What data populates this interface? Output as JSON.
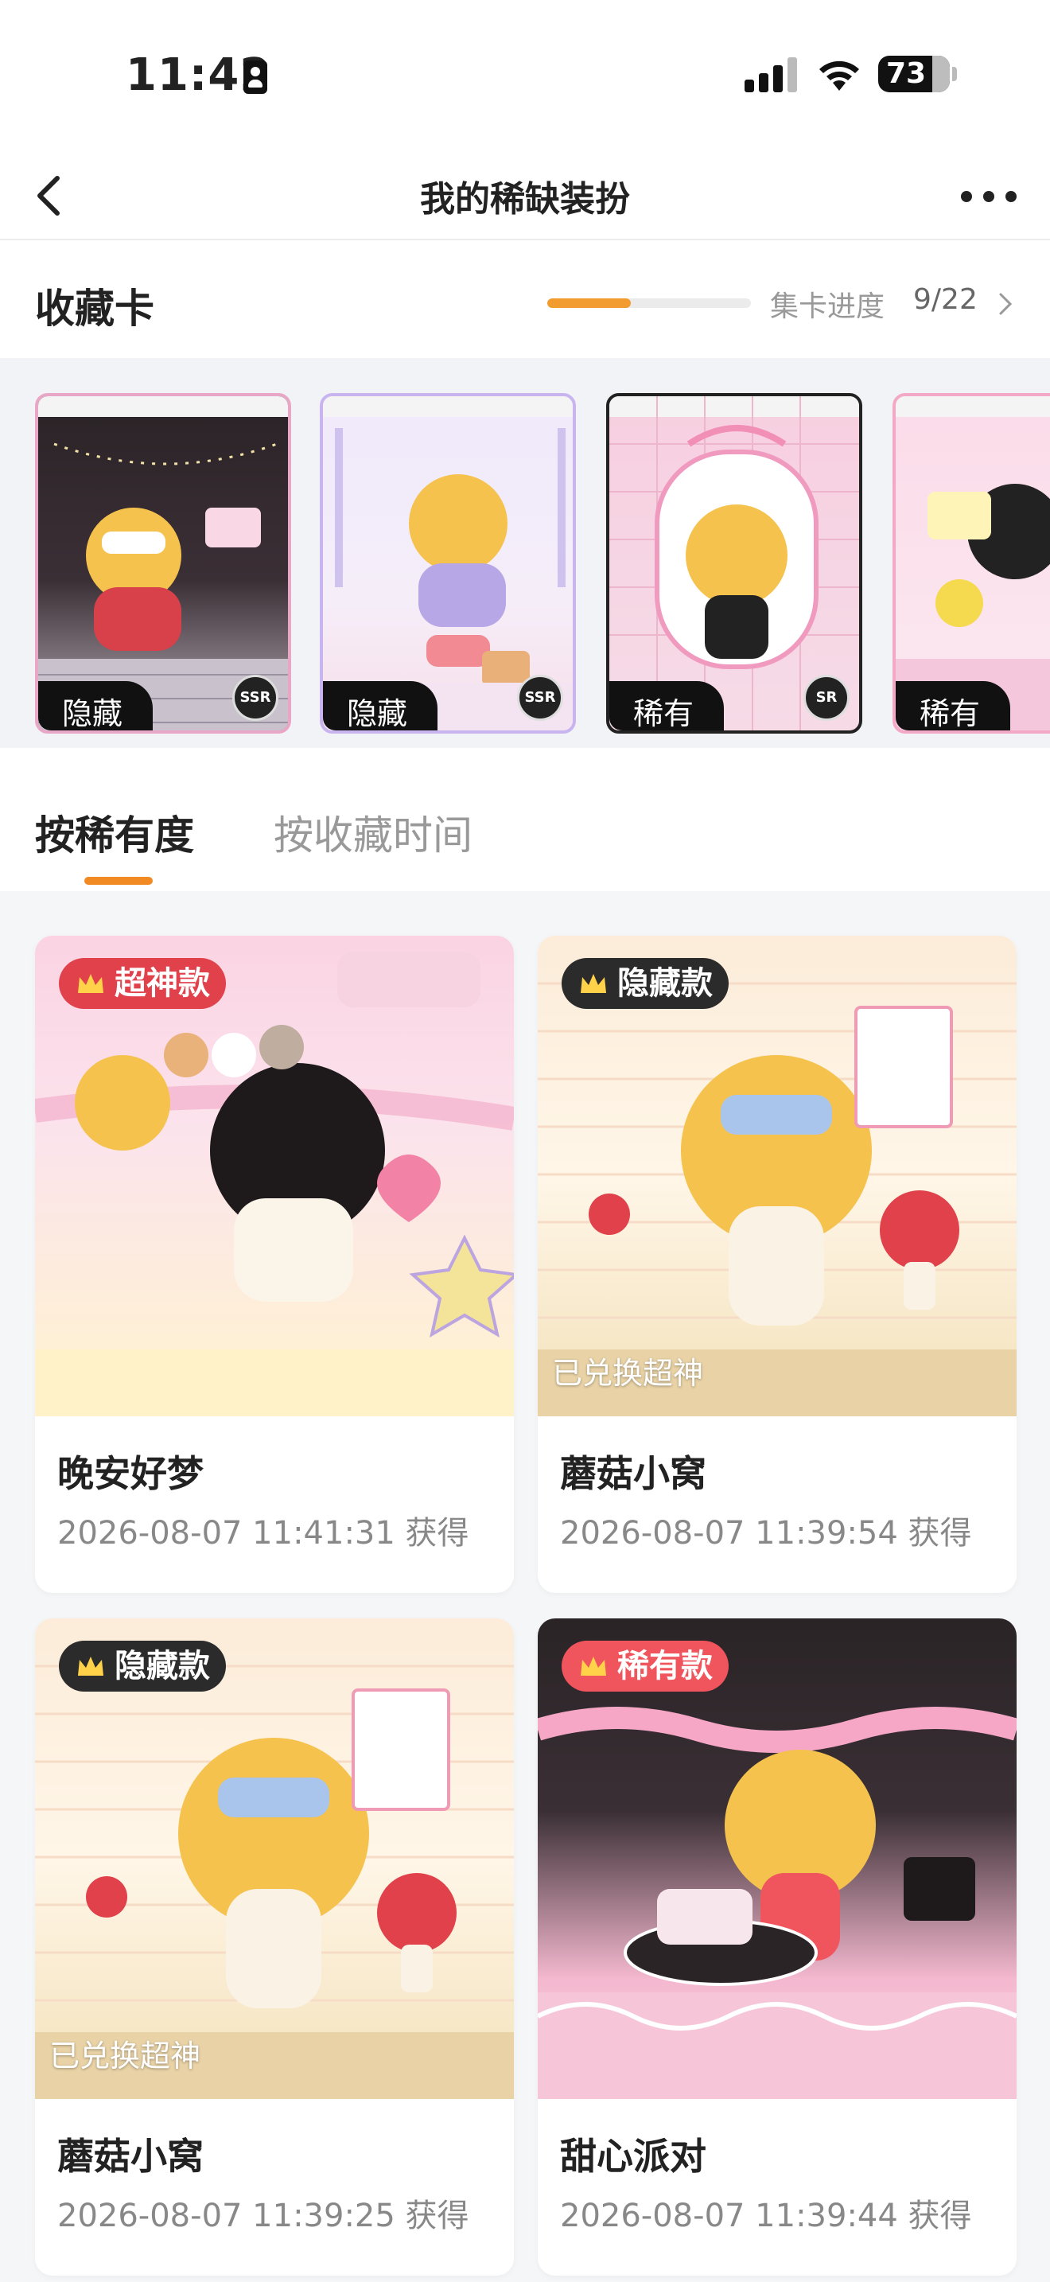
{
  "status_bar": {
    "time": "11:42",
    "battery": "73"
  },
  "nav": {
    "title": "我的稀缺装扮",
    "back_icon": "chevron-left-icon",
    "more_icon": "more-dots-icon"
  },
  "collection": {
    "title": "收藏卡",
    "progress_label": "集卡进度",
    "progress_count": "9/22",
    "progress_fraction": 0.41,
    "cards": [
      {
        "rarity": "隐藏",
        "grade": "SSR",
        "theme": "dark"
      },
      {
        "rarity": "隐藏",
        "grade": "SSR",
        "theme": "lavender"
      },
      {
        "rarity": "稀有",
        "grade": "SR",
        "theme": "pink"
      },
      {
        "rarity": "稀有",
        "grade": "",
        "theme": "pastel"
      }
    ]
  },
  "tabs": {
    "active": "按稀有度",
    "inactive": "按收藏时间"
  },
  "items": [
    {
      "badge": "超神款",
      "badge_color": "#e0414b",
      "name": "晚安好梦",
      "time": "2026-08-07 11:41:31 获得",
      "redeemed": ""
    },
    {
      "badge": "隐藏款",
      "badge_color": "#2b2b2b",
      "name": "蘑菇小窝",
      "time": "2026-08-07 11:39:54 获得",
      "redeemed": "已兑换超神"
    },
    {
      "badge": "隐藏款",
      "badge_color": "#2b2b2b",
      "name": "蘑菇小窝",
      "time": "2026-08-07 11:39:25 获得",
      "redeemed": "已兑换超神"
    },
    {
      "badge": "稀有款",
      "badge_color": "#f0545c",
      "name": "甜心派对",
      "time": "2026-08-07 11:39:44 获得",
      "redeemed": ""
    }
  ],
  "colors": {
    "accent": "#f28a23",
    "progress": "#f29b2e"
  }
}
